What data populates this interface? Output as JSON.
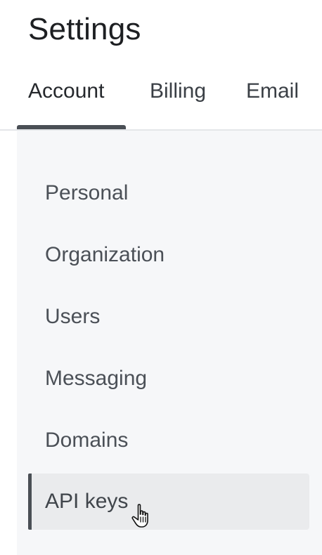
{
  "header": {
    "title": "Settings"
  },
  "tabs": [
    {
      "label": "Account",
      "active": true
    },
    {
      "label": "Billing",
      "active": false
    },
    {
      "label": "Email",
      "active": false
    }
  ],
  "account_nav": {
    "items": [
      {
        "label": "Personal",
        "selected": false
      },
      {
        "label": "Organization",
        "selected": false
      },
      {
        "label": "Users",
        "selected": false
      },
      {
        "label": "Messaging",
        "selected": false
      },
      {
        "label": "Domains",
        "selected": false
      },
      {
        "label": "API keys",
        "selected": true
      }
    ]
  },
  "cursor": {
    "type": "pointer-hand-icon"
  },
  "colors": {
    "panel_background": "#f6f7f9",
    "selected_item_background": "#eaebed",
    "active_indicator": "#4a4f55"
  }
}
